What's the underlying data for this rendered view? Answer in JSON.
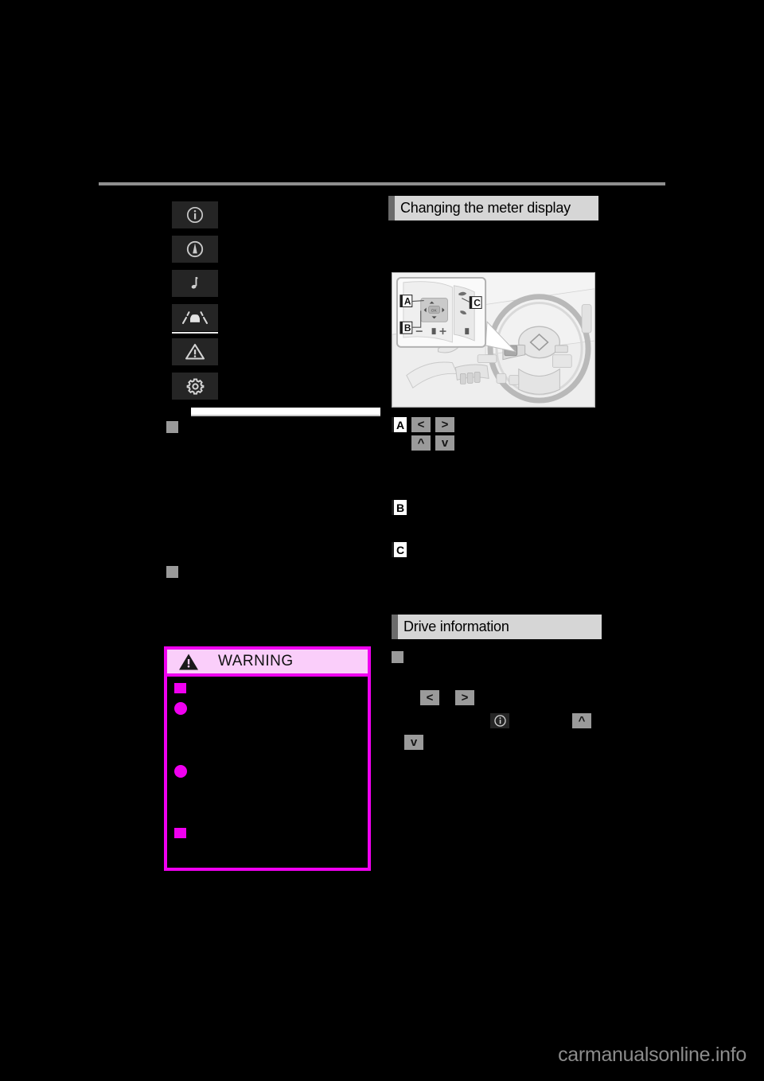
{
  "page": {
    "background_color": "#000000",
    "watermark": "carmanualsonline.info"
  },
  "left_column": {
    "meter_icons": [
      {
        "name": "info-icon",
        "label": "Information"
      },
      {
        "name": "speedometer-icon",
        "label": "Meter / gauge"
      },
      {
        "name": "music-note-icon",
        "label": "Audio"
      },
      {
        "name": "lane-departure-icon",
        "label": "Driving assist"
      },
      {
        "name": "warning-triangle-icon",
        "label": "Warning"
      },
      {
        "name": "gear-icon",
        "label": "Settings"
      }
    ],
    "section_heading_marker": "square-bullet",
    "sections": [
      {
        "bullet": "square",
        "title_redacted": true
      },
      {
        "bullet": "square",
        "title_redacted": true
      }
    ]
  },
  "warning_box": {
    "title": "WARNING",
    "icon": "warning-triangle-icon",
    "border_color": "#f000f0",
    "header_color": "#facefa",
    "bullets": [
      {
        "type": "square"
      },
      {
        "type": "dot"
      },
      {
        "type": "dot"
      },
      {
        "type": "square"
      }
    ]
  },
  "right_column": {
    "section_1": {
      "heading": "Changing the meter display",
      "illustration": {
        "name": "steering-wheel-controls-illustration",
        "callout_labels": [
          "A",
          "B",
          "C"
        ]
      },
      "callouts": [
        {
          "tag": "A",
          "keys": [
            [
              "<",
              ">"
            ],
            [
              "^",
              "v"
            ]
          ]
        },
        {
          "tag": "B",
          "keys": []
        },
        {
          "tag": "C",
          "keys": []
        }
      ]
    },
    "section_2": {
      "heading": "Drive information",
      "bullet": "square",
      "inline_keys": [
        {
          "glyph": "<",
          "style": "gray"
        },
        {
          "glyph": ">",
          "style": "gray"
        },
        {
          "glyph": "info",
          "style": "dark"
        },
        {
          "glyph": "^",
          "style": "gray"
        },
        {
          "glyph": "v",
          "style": "gray"
        }
      ]
    }
  }
}
